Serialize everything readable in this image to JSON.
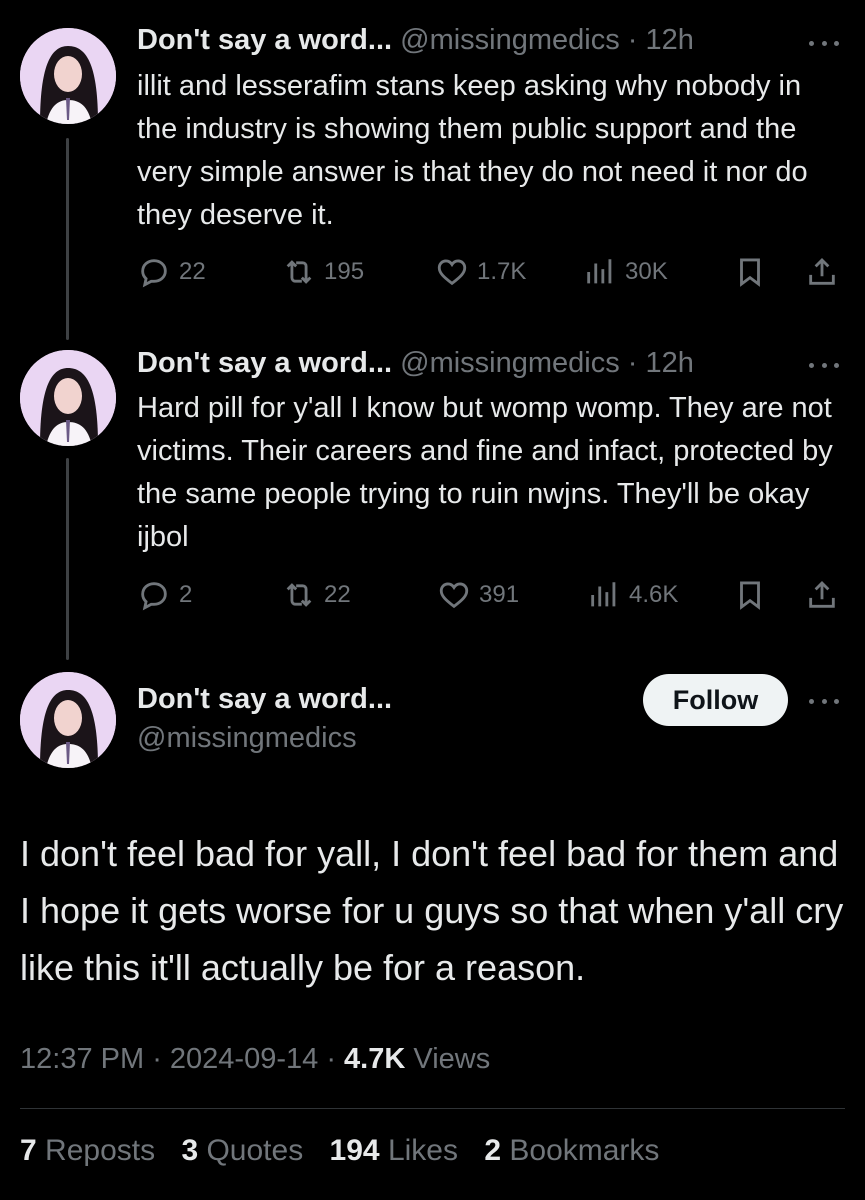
{
  "tweets": [
    {
      "name": "Don't say a word...",
      "handle": "@missingmedics",
      "time": "12h",
      "text": "illit and lesserafim stans keep asking why nobody in the industry is showing them public support and the very simple answer is that they do not need it nor do they deserve it.",
      "replies": "22",
      "reposts": "195",
      "likes": "1.7K",
      "views": "30K"
    },
    {
      "name": "Don't say a word...",
      "handle": "@missingmedics",
      "time": "12h",
      "text": "Hard pill for y'all I know but womp womp. They are not victims. Their careers and fine and infact, protected by the same people trying to ruin nwjns. They'll be okay ijbol",
      "replies": "2",
      "reposts": "22",
      "likes": "391",
      "views": "4.6K"
    }
  ],
  "main": {
    "name": "Don't say a word...",
    "handle": "@missingmedics",
    "follow_label": "Follow",
    "text": "I don't feel bad for yall, I don't feel bad for them and I hope it gets worse for u guys so that when y'all cry like this it'll actually be for a reason.",
    "time": "12:37 PM",
    "date": "2024-09-14",
    "views_count": "4.7K",
    "views_label": "Views",
    "stats": {
      "reposts": "7",
      "reposts_label": "Reposts",
      "quotes": "3",
      "quotes_label": "Quotes",
      "likes": "194",
      "likes_label": "Likes",
      "bookmarks": "2",
      "bookmarks_label": "Bookmarks"
    }
  },
  "icons": [
    "reply-icon",
    "repost-icon",
    "like-icon",
    "views-icon",
    "bookmark-icon",
    "share-icon",
    "more-icon"
  ],
  "colors": {
    "background": "#000000",
    "text": "#e7e9ea",
    "muted": "#71767b",
    "follow_bg": "#eff3f4"
  }
}
